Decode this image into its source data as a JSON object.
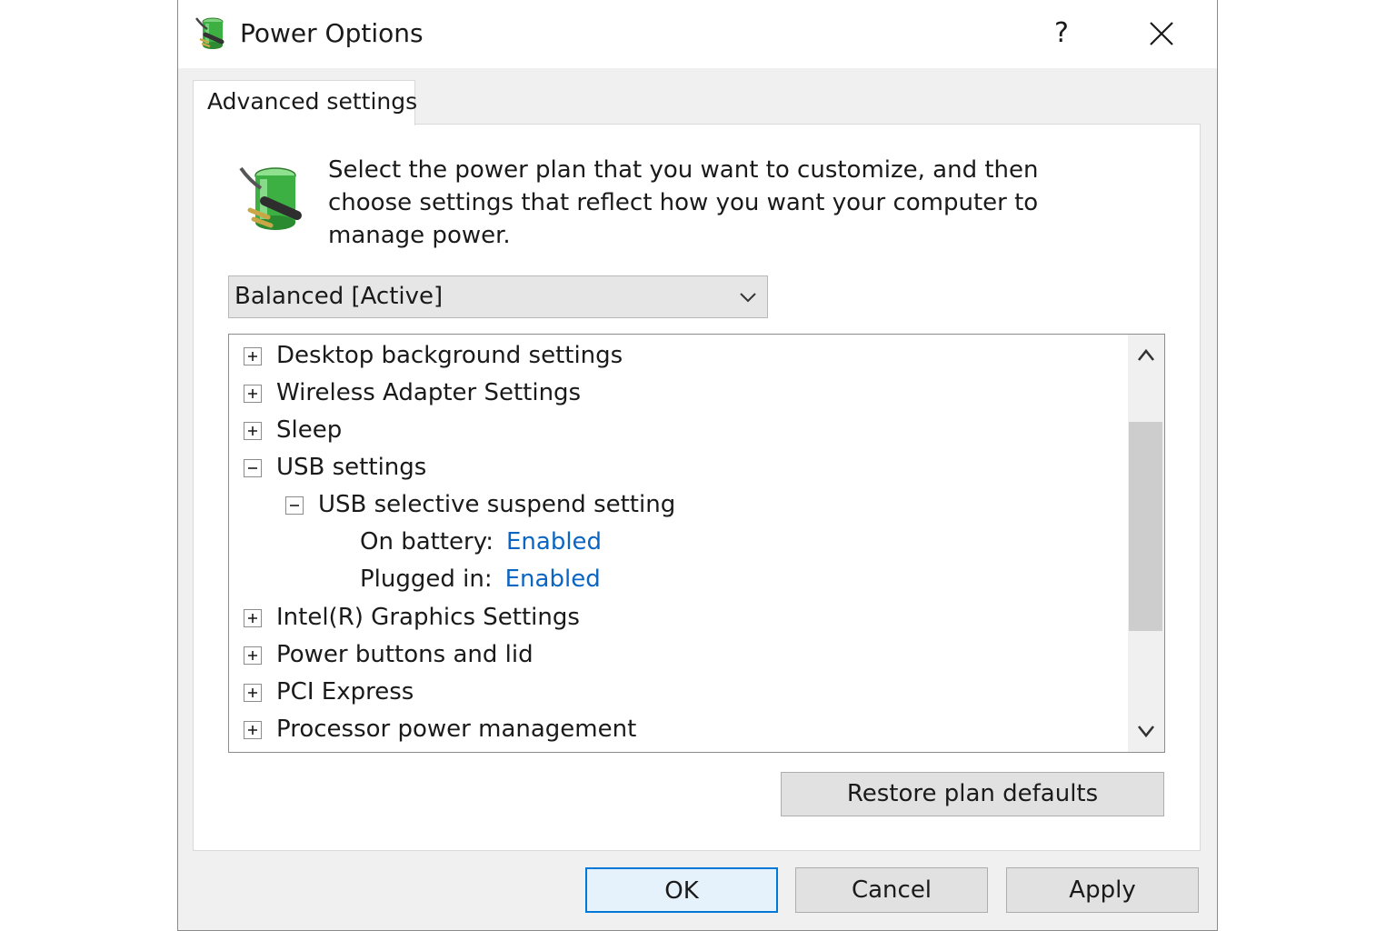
{
  "window": {
    "title": "Power Options",
    "help_label": "?",
    "icons": {
      "title": "power-plug-battery-icon",
      "close": "close-icon"
    }
  },
  "tab": {
    "label": "Advanced settings"
  },
  "description": "Select the power plan that you want to customize, and then choose settings that reflect how you want your computer to manage power.",
  "plan_select": {
    "value": "Balanced [Active]"
  },
  "tree": {
    "items": [
      {
        "label": "Desktop background settings",
        "expanded": false
      },
      {
        "label": "Wireless Adapter Settings",
        "expanded": false
      },
      {
        "label": "Sleep",
        "expanded": false
      },
      {
        "label": "USB settings",
        "expanded": true
      },
      {
        "label": "USB selective suspend setting",
        "expanded": true
      },
      {
        "label": "On battery:",
        "value": "Enabled"
      },
      {
        "label": "Plugged in:",
        "value": "Enabled"
      },
      {
        "label": "Intel(R) Graphics Settings",
        "expanded": false
      },
      {
        "label": "Power buttons and lid",
        "expanded": false
      },
      {
        "label": "PCI Express",
        "expanded": false
      },
      {
        "label": "Processor power management",
        "expanded": false
      }
    ]
  },
  "buttons": {
    "restore": "Restore plan defaults",
    "ok": "OK",
    "cancel": "Cancel",
    "apply": "Apply"
  },
  "colors": {
    "link": "#0a66c2",
    "focus_border": "#0078d7",
    "icon_green": "#3cb043"
  }
}
